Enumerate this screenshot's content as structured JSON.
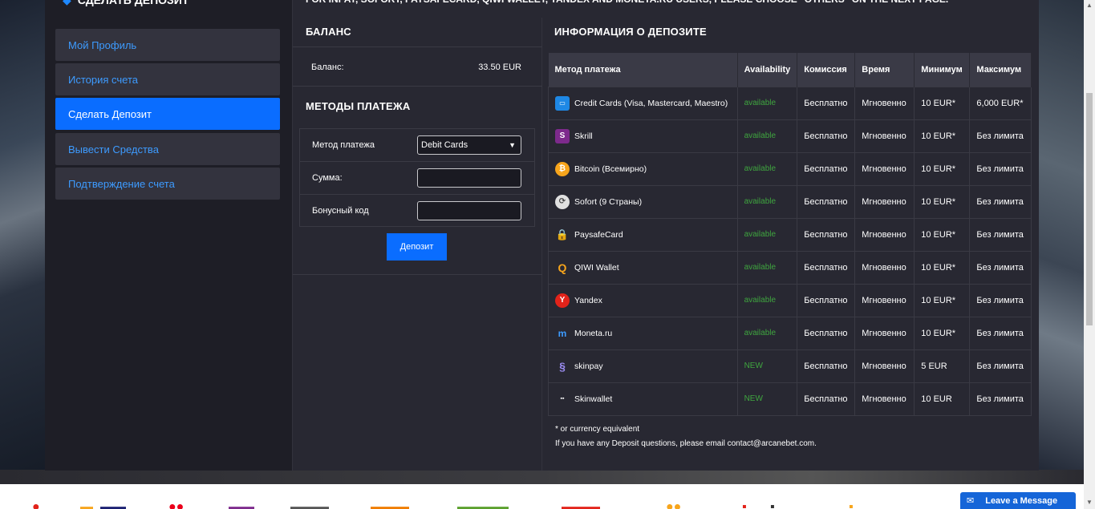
{
  "top_note": "FOR INPAY, SOFORT, PAYSAFECARD, QIWI WALLET, YANDEX AND MONETA.RU USERS, PLEASE CHOOSE \"OTHERS\" ON THE NEXT PAGE.",
  "sidebar": {
    "header": "СДЕЛАТЬ ДЕПОЗИТ",
    "items": [
      {
        "label": "Мой Профиль"
      },
      {
        "label": "История счета"
      },
      {
        "label": "Сделать Депозит"
      },
      {
        "label": "Вывести Средства"
      },
      {
        "label": "Подтверждение счета"
      }
    ]
  },
  "balance": {
    "title": "БАЛАНС",
    "label": "Баланс:",
    "value": "33.50 EUR"
  },
  "methods": {
    "title": "МЕТОДЫ ПЛАТЕЖА",
    "method_label": "Метод платежа",
    "method_value": "Debit Cards",
    "amount_label": "Сумма:",
    "amount_value": "",
    "bonus_label": "Бонусный код",
    "bonus_value": "",
    "deposit_button": "Депозит"
  },
  "info": {
    "title": "ИНФОРМАЦИЯ О ДЕПОЗИТЕ",
    "columns": [
      "Метод платежа",
      "Availability",
      "Комиссия",
      "Время",
      "Минимум",
      "Максимум"
    ],
    "rows": [
      {
        "method": "Credit Cards (Visa, Mastercard, Maestro)",
        "icon": "credit-card-icon",
        "availability": "available",
        "fee": "Бесплатно",
        "time": "Мгновенно",
        "min": "10 EUR*",
        "max": "6,000 EUR*"
      },
      {
        "method": "Skrill",
        "icon": "skrill-icon",
        "availability": "available",
        "fee": "Бесплатно",
        "time": "Мгновенно",
        "min": "10 EUR*",
        "max": "Без лимита"
      },
      {
        "method": "Bitcoin (Всемирно)",
        "icon": "bitcoin-icon",
        "availability": "available",
        "fee": "Бесплатно",
        "time": "Мгновенно",
        "min": "10 EUR*",
        "max": "Без лимита"
      },
      {
        "method": "Sofort (9 Страны)",
        "icon": "sofort-icon",
        "availability": "available",
        "fee": "Бесплатно",
        "time": "Мгновенно",
        "min": "10 EUR*",
        "max": "Без лимита"
      },
      {
        "method": "PaysafeCard",
        "icon": "paysafecard-icon",
        "availability": "available",
        "fee": "Бесплатно",
        "time": "Мгновенно",
        "min": "10 EUR*",
        "max": "Без лимита"
      },
      {
        "method": "QIWI Wallet",
        "icon": "qiwi-icon",
        "availability": "available",
        "fee": "Бесплатно",
        "time": "Мгновенно",
        "min": "10 EUR*",
        "max": "Без лимита"
      },
      {
        "method": "Yandex",
        "icon": "yandex-icon",
        "availability": "available",
        "fee": "Бесплатно",
        "time": "Мгновенно",
        "min": "10 EUR*",
        "max": "Без лимита"
      },
      {
        "method": "Moneta.ru",
        "icon": "moneta-icon",
        "availability": "available",
        "fee": "Бесплатно",
        "time": "Мгновенно",
        "min": "10 EUR*",
        "max": "Без лимита"
      },
      {
        "method": "skinpay",
        "icon": "skinpay-icon",
        "availability": "NEW",
        "fee": "Бесплатно",
        "time": "Мгновенно",
        "min": "5 EUR",
        "max": "Без лимита"
      },
      {
        "method": "Skinwallet",
        "icon": "skinwallet-icon",
        "availability": "NEW",
        "fee": "Бесплатно",
        "time": "Мгновенно",
        "min": "10 EUR",
        "max": "Без лимита"
      }
    ],
    "footnote": "* or currency equivalent",
    "contact": "If you have any Deposit questions, please email contact@arcanebet.com."
  },
  "chat": {
    "label": "Leave a Message"
  },
  "colors": {
    "accent": "#0a6dff",
    "link": "#3d9bff",
    "available": "#3fa63f",
    "panel": "#282832",
    "sidebar": "#1e1e26"
  }
}
